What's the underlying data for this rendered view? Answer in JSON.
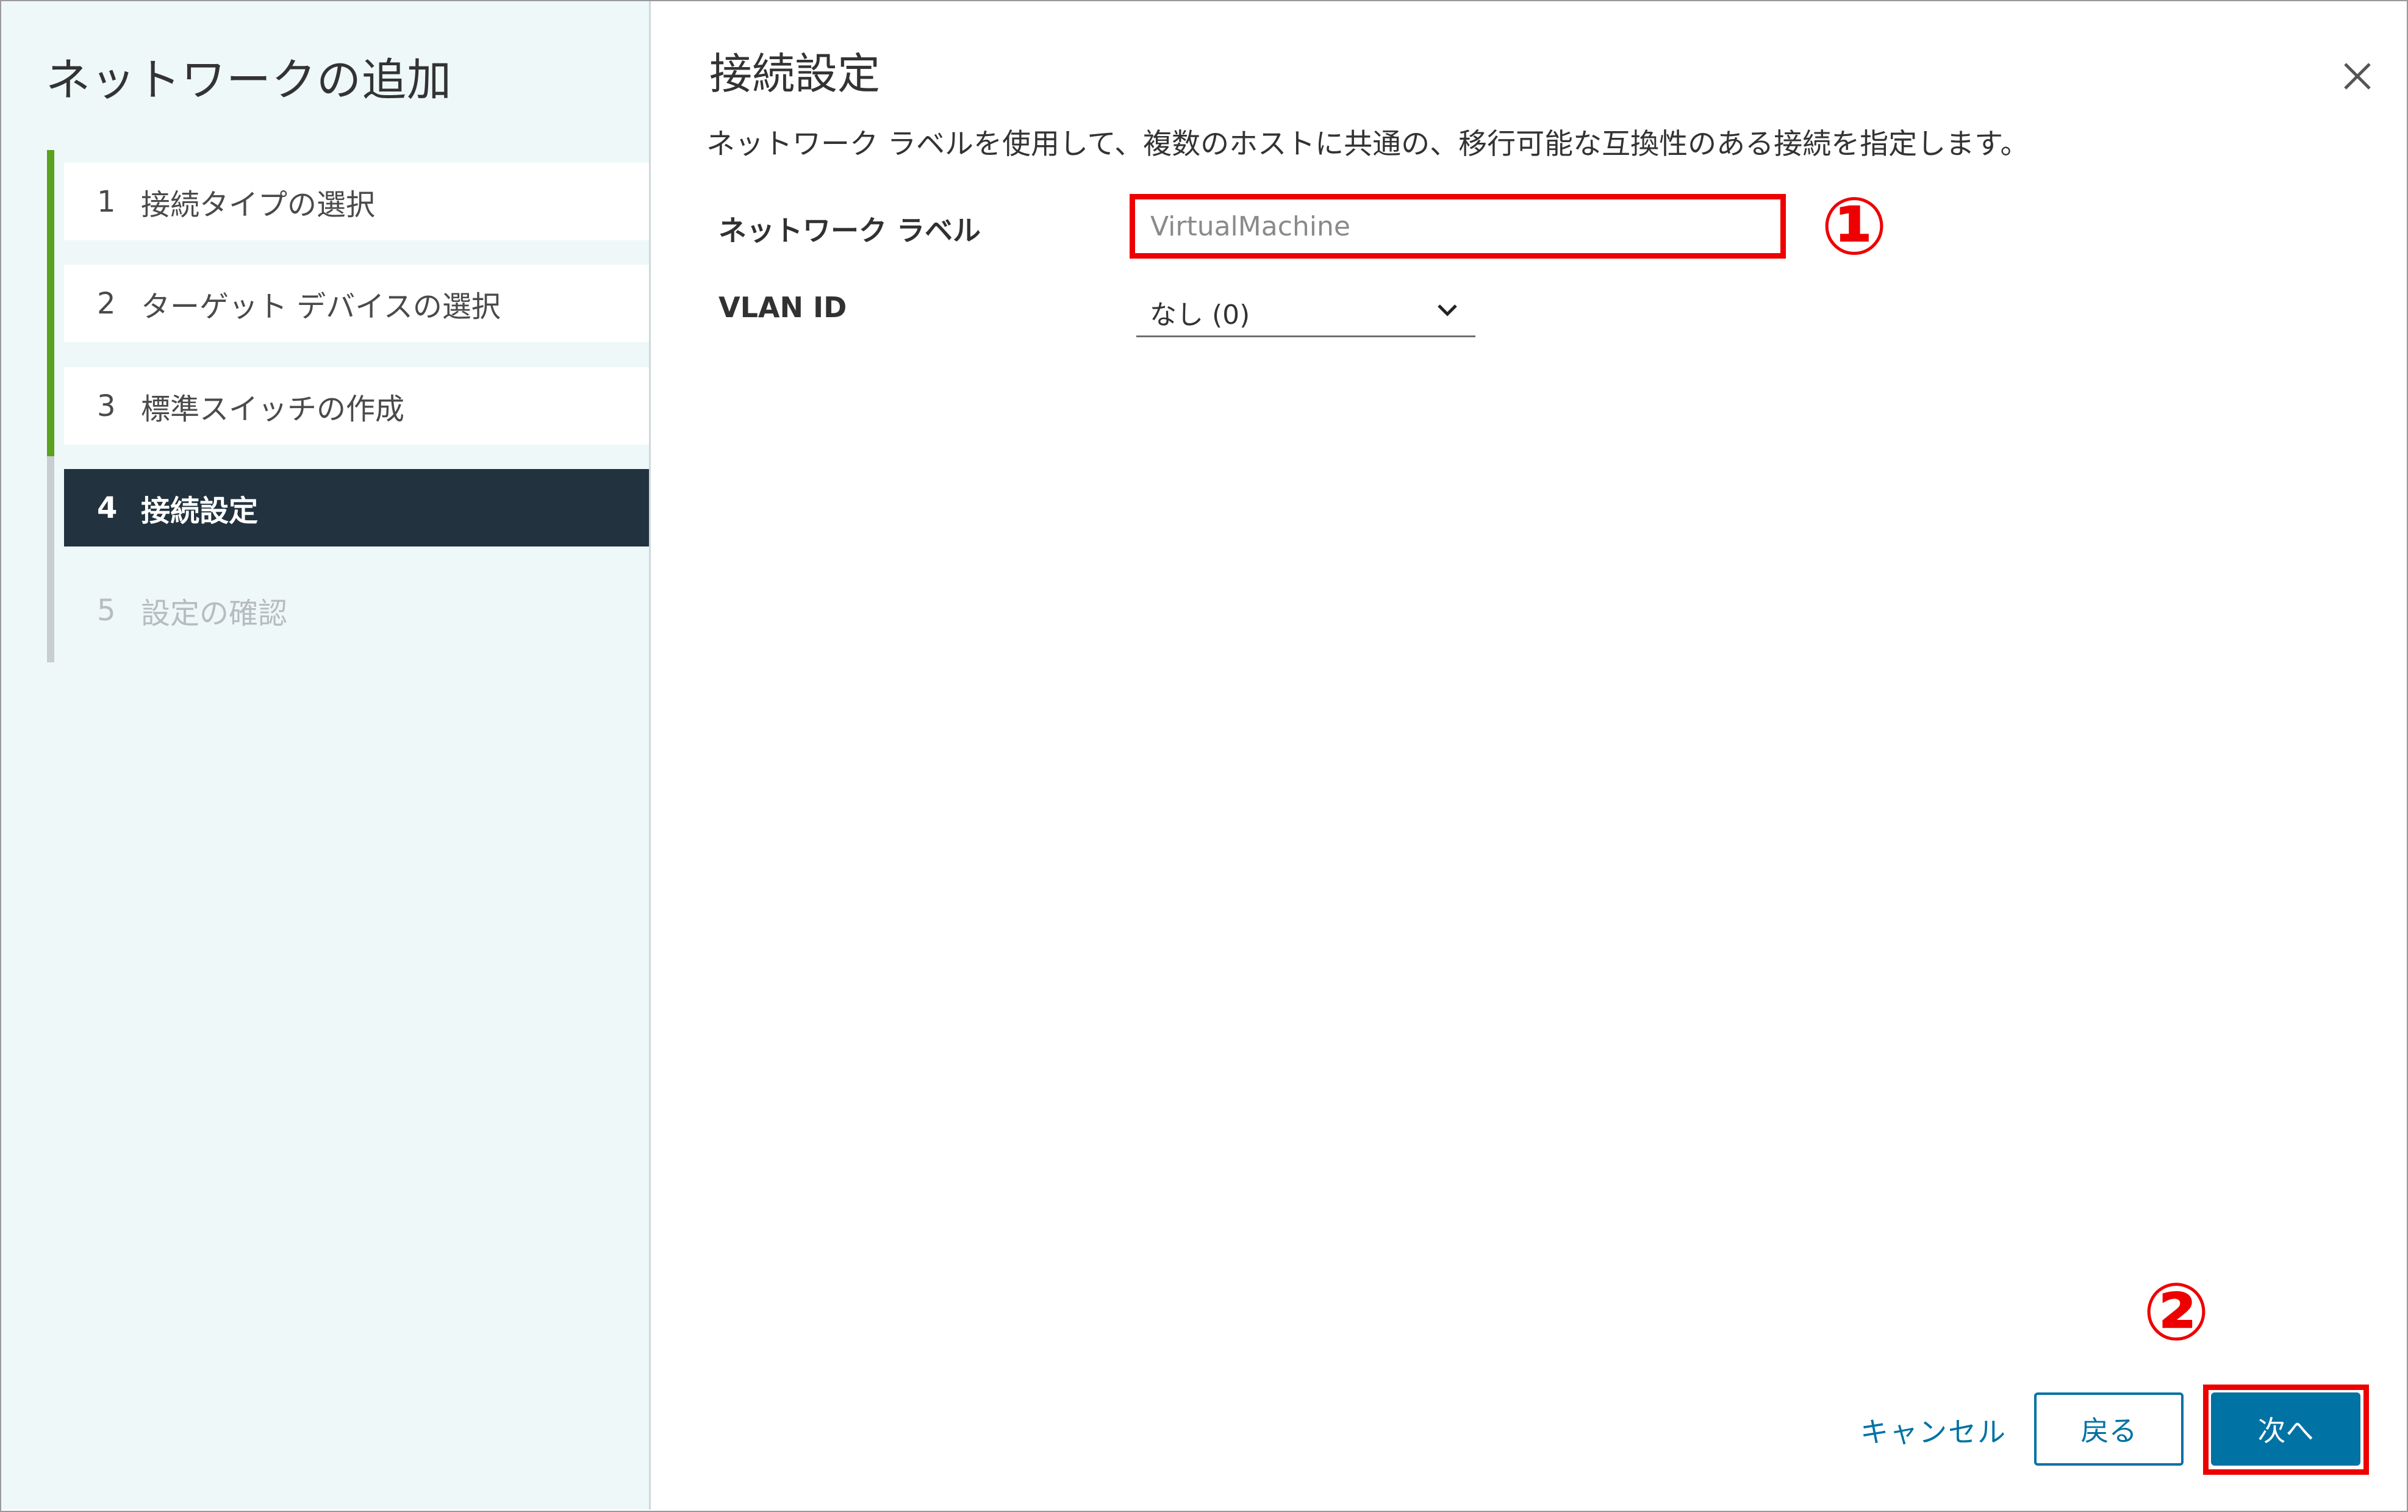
{
  "wizard": {
    "title": "ネットワークの追加",
    "steps": [
      {
        "num": "1",
        "label": "接続タイプの選択",
        "state": "done"
      },
      {
        "num": "2",
        "label": "ターゲット デバイスの選択",
        "state": "done"
      },
      {
        "num": "3",
        "label": "標準スイッチの作成",
        "state": "done"
      },
      {
        "num": "4",
        "label": "接続設定",
        "state": "active"
      },
      {
        "num": "5",
        "label": "設定の確認",
        "state": "future"
      }
    ]
  },
  "page": {
    "title": "接続設定",
    "description": "ネットワーク ラベルを使用して、複数のホストに共通の、移行可能な互換性のある接続を指定します。"
  },
  "form": {
    "network_label": {
      "label": "ネットワーク ラベル",
      "value": "VirtualMachine"
    },
    "vlan_id": {
      "label": "VLAN ID",
      "selected": "なし (0)"
    }
  },
  "footer": {
    "cancel": "キャンセル",
    "back": "戻る",
    "next": "次へ"
  },
  "annotations": {
    "marker1": "①",
    "marker2": "②",
    "color": "#ee0000"
  },
  "icons": {
    "close": "close-icon",
    "dropdown": "chevron-down-icon"
  },
  "colors": {
    "accent": "#0072a3",
    "active_step_bg": "#22323e",
    "progress_done": "#5aa220",
    "left_pane_bg": "#eff8f8"
  }
}
